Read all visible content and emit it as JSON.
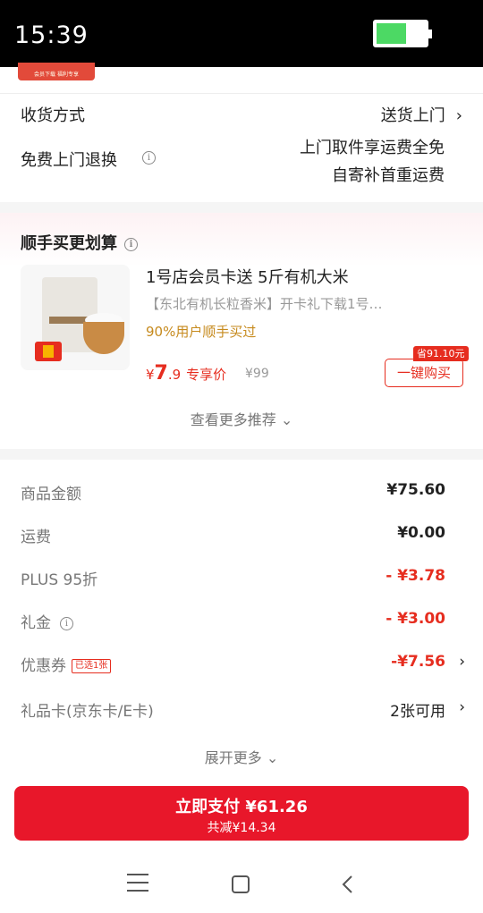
{
  "status": {
    "time": "15:39",
    "battery_percent": 62
  },
  "promo_strip": {
    "text": "会员下载 福利专享"
  },
  "delivery": {
    "method_label": "收货方式",
    "method_value": "送货上门",
    "return_label": "免费上门退换",
    "return_line1": "上门取件享运费全免",
    "return_line2": "自寄补首重运费"
  },
  "recommend": {
    "title": "顺手买更划算",
    "product": {
      "title": "1号店会员卡送 5斤有机大米",
      "desc": "【东北有机长粒香米】开卡礼下载1号…",
      "bought": "90%用户顺手买过",
      "price_symbol": "¥",
      "price_int": "7",
      "price_dec": ".9",
      "price_tag": "专享价",
      "orig_price": "¥99",
      "save_tag": "省91.10元",
      "buy_label": "一键购买"
    },
    "more_label": "查看更多推荐"
  },
  "summary": {
    "rows": [
      {
        "label": "商品金额",
        "value": "¥75.60"
      },
      {
        "label": "运费",
        "value": "¥0.00"
      },
      {
        "label": "PLUS 95折",
        "value": "- ¥3.78"
      },
      {
        "label": "礼金",
        "value": "- ¥3.00"
      },
      {
        "label": "优惠券",
        "tag": "已选1张",
        "value": "-¥7.56"
      },
      {
        "label": "礼品卡(京东卡/E卡)",
        "value": "2张可用"
      }
    ],
    "expand_label": "展开更多"
  },
  "pay": {
    "main": "立即支付 ¥61.26",
    "sub": "共减¥14.34"
  },
  "colors": {
    "accent": "#e62d1f",
    "pay_button": "#e8172a",
    "gold": "#c68a1d"
  },
  "icons": [
    "info-icon",
    "chevron-right-icon",
    "chevron-down-icon",
    "menu-icon",
    "home-icon",
    "back-icon"
  ]
}
